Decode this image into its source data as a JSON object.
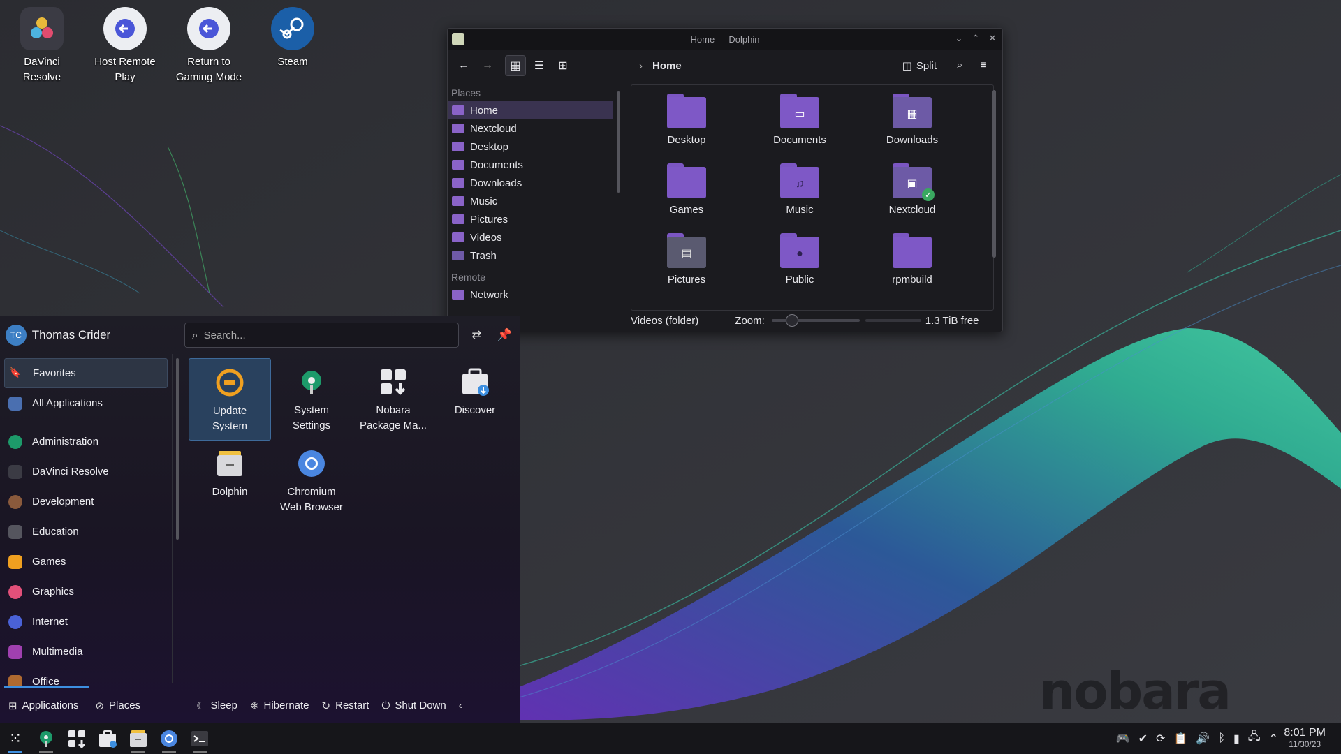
{
  "desktop": {
    "icons": [
      {
        "label_line1": "DaVinci",
        "label_line2": "Resolve",
        "icon": "davinci-resolve-icon"
      },
      {
        "label_line1": "Host Remote",
        "label_line2": "Play",
        "icon": "host-remote-play-icon"
      },
      {
        "label_line1": "Return to",
        "label_line2": "Gaming Mode",
        "icon": "return-gaming-icon"
      },
      {
        "label_line1": "Steam",
        "label_line2": "",
        "icon": "steam-icon"
      }
    ],
    "watermark": "nobara"
  },
  "dolphin": {
    "title": "Home — Dolphin",
    "breadcrumb": "Home",
    "split_label": "Split",
    "places_header": "Places",
    "places": [
      "Home",
      "Nextcloud",
      "Desktop",
      "Documents",
      "Downloads",
      "Music",
      "Pictures",
      "Videos",
      "Trash"
    ],
    "remote_header": "Remote",
    "remote": [
      "Network"
    ],
    "folders": [
      "Desktop",
      "Documents",
      "Downloads",
      "Games",
      "Music",
      "Nextcloud",
      "Pictures",
      "Public",
      "rpmbuild"
    ],
    "status_text": "Videos (folder)",
    "zoom_label": "Zoom:",
    "free_space": "1.3 TiB free"
  },
  "launcher": {
    "user_initials": "TC",
    "user_name": "Thomas Crider",
    "search_placeholder": "Search...",
    "categories": [
      "Favorites",
      "All Applications",
      "Administration",
      "DaVinci Resolve",
      "Development",
      "Education",
      "Games",
      "Graphics",
      "Internet",
      "Multimedia",
      "Office"
    ],
    "apps": [
      {
        "line1": "Update",
        "line2": "System"
      },
      {
        "line1": "System",
        "line2": "Settings"
      },
      {
        "line1": "Nobara",
        "line2": "Package Ma..."
      },
      {
        "line1": "Discover",
        "line2": ""
      },
      {
        "line1": "Dolphin",
        "line2": ""
      },
      {
        "line1": "Chromium",
        "line2": "Web Browser"
      }
    ],
    "bottom": {
      "applications": "Applications",
      "places": "Places",
      "sleep": "Sleep",
      "hibernate": "Hibernate",
      "restart": "Restart",
      "shutdown": "Shut Down"
    }
  },
  "taskbar": {
    "time": "8:01 PM",
    "date": "11/30/23"
  },
  "colors": {
    "accent": "#3d8fe0",
    "folder": "#7e58c6",
    "selection": "#3a3350"
  }
}
